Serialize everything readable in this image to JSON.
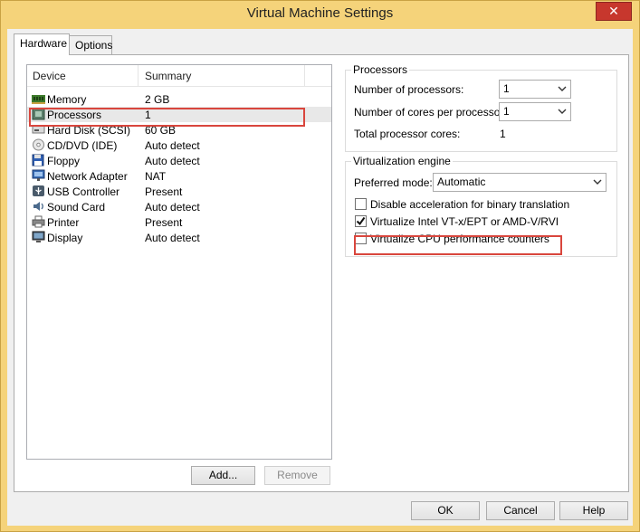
{
  "window": {
    "title": "Virtual Machine Settings",
    "close_glyph": "✕"
  },
  "tabs": [
    {
      "label": "Hardware",
      "active": true
    },
    {
      "label": "Options",
      "active": false
    }
  ],
  "device_list": {
    "columns": [
      "Device",
      "Summary"
    ],
    "items": [
      {
        "name": "Memory",
        "summary": "2 GB",
        "icon": "memory-icon"
      },
      {
        "name": "Processors",
        "summary": "1",
        "icon": "processor-icon",
        "selected": true
      },
      {
        "name": "Hard Disk (SCSI)",
        "summary": "60 GB",
        "icon": "hard-disk-icon"
      },
      {
        "name": "CD/DVD (IDE)",
        "summary": "Auto detect",
        "icon": "cd-dvd-icon"
      },
      {
        "name": "Floppy",
        "summary": "Auto detect",
        "icon": "floppy-icon"
      },
      {
        "name": "Network Adapter",
        "summary": "NAT",
        "icon": "network-adapter-icon"
      },
      {
        "name": "USB Controller",
        "summary": "Present",
        "icon": "usb-icon"
      },
      {
        "name": "Sound Card",
        "summary": "Auto detect",
        "icon": "sound-card-icon"
      },
      {
        "name": "Printer",
        "summary": "Present",
        "icon": "printer-icon"
      },
      {
        "name": "Display",
        "summary": "Auto detect",
        "icon": "display-icon"
      }
    ],
    "add_label": "Add...",
    "remove_label": "Remove"
  },
  "processors": {
    "title": "Processors",
    "num_processors_label": "Number of processors:",
    "num_processors_value": "1",
    "cores_label": "Number of cores per processor:",
    "cores_value": "1",
    "total_label": "Total processor cores:",
    "total_value": "1"
  },
  "virtualization": {
    "title": "Virtualization engine",
    "mode_label": "Preferred mode:",
    "mode_value": "Automatic",
    "options": [
      {
        "label": "Disable acceleration for binary translation",
        "checked": false
      },
      {
        "label": "Virtualize Intel VT-x/EPT or AMD-V/RVI",
        "checked": true
      },
      {
        "label": "Virtualize CPU performance counters",
        "checked": false
      }
    ]
  },
  "footer": {
    "ok_label": "OK",
    "cancel_label": "Cancel",
    "help_label": "Help"
  },
  "colors": {
    "titlebar": "#f5d37a",
    "highlight": "#d9463d",
    "close": "#c7372d"
  }
}
